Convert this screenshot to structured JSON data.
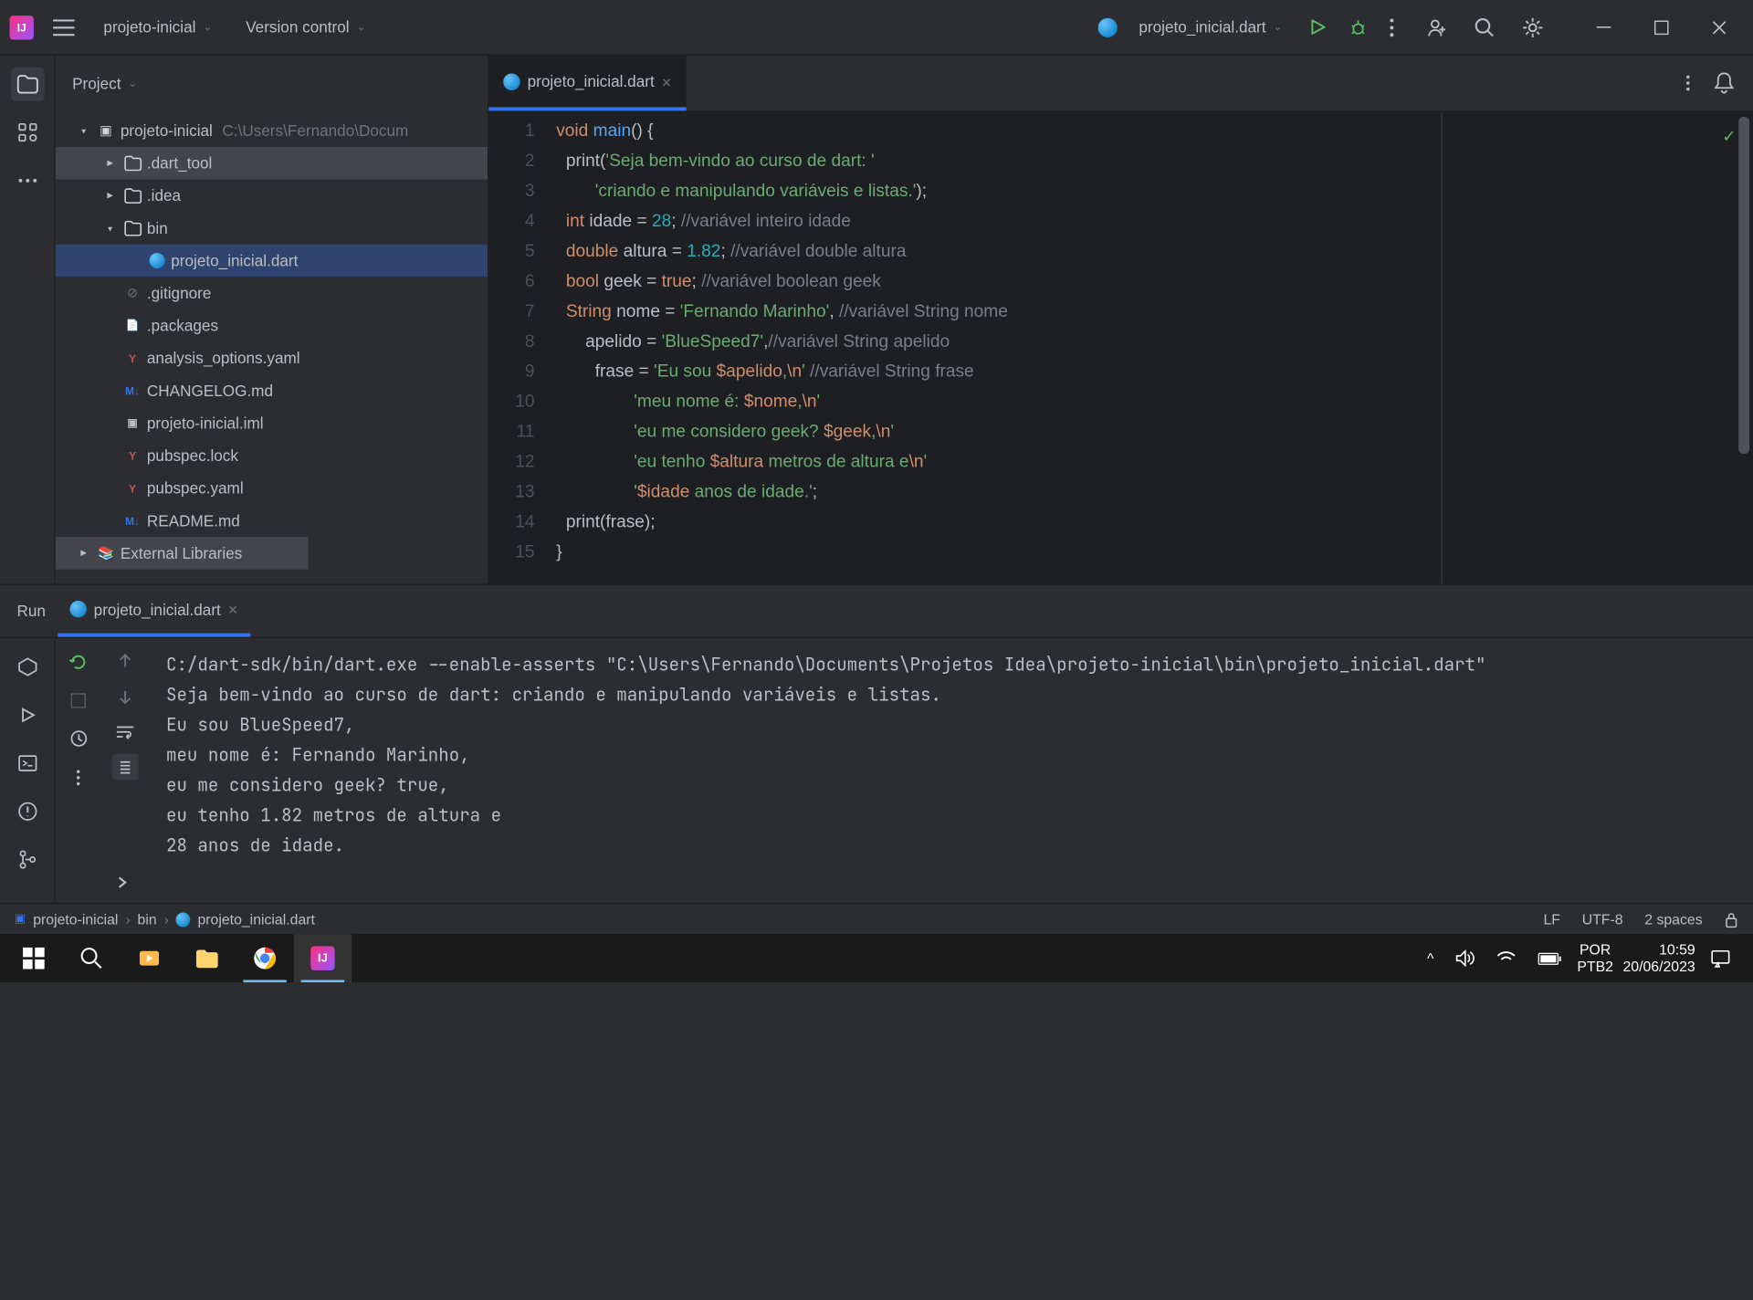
{
  "titlebar": {
    "project_name": "projeto-inicial",
    "vcs": "Version control",
    "run_config": "projeto_inicial.dart"
  },
  "panel": {
    "title": "Project"
  },
  "tree": {
    "root": "projeto-inicial",
    "root_path": "C:\\Users\\Fernando\\Docum",
    "items": [
      {
        "label": ".dart_tool",
        "type": "folder",
        "indent": 1,
        "arrow": "right",
        "highlighted": true
      },
      {
        "label": ".idea",
        "type": "folder",
        "indent": 1,
        "arrow": "right"
      },
      {
        "label": "bin",
        "type": "folder",
        "indent": 1,
        "arrow": "down"
      },
      {
        "label": "projeto_inicial.dart",
        "type": "dart",
        "indent": 2,
        "selected": true
      },
      {
        "label": ".gitignore",
        "type": "ignore",
        "indent": 1
      },
      {
        "label": ".packages",
        "type": "file",
        "indent": 1
      },
      {
        "label": "analysis_options.yaml",
        "type": "yaml",
        "indent": 1
      },
      {
        "label": "CHANGELOG.md",
        "type": "md",
        "indent": 1
      },
      {
        "label": "projeto-inicial.iml",
        "type": "iml",
        "indent": 1
      },
      {
        "label": "pubspec.lock",
        "type": "yaml",
        "indent": 1
      },
      {
        "label": "pubspec.yaml",
        "type": "yaml",
        "indent": 1
      },
      {
        "label": "README.md",
        "type": "md",
        "indent": 1
      }
    ],
    "external": "External Libraries"
  },
  "tabs": {
    "current": "projeto_inicial.dart"
  },
  "code": {
    "lines": [
      {
        "n": 1,
        "tokens": [
          [
            "kw",
            "void"
          ],
          [
            "op",
            " "
          ],
          [
            "fn",
            "main"
          ],
          [
            "op",
            "() {"
          ]
        ]
      },
      {
        "n": 2,
        "tokens": [
          [
            "op",
            "  print("
          ],
          [
            "str",
            "'Seja bem-vindo ao curso de dart: '"
          ]
        ]
      },
      {
        "n": 3,
        "tokens": [
          [
            "op",
            "        "
          ],
          [
            "str",
            "'criando e manipulando variáveis e listas.'"
          ],
          [
            "op",
            ");"
          ]
        ]
      },
      {
        "n": 4,
        "tokens": [
          [
            "op",
            "  "
          ],
          [
            "kw",
            "int"
          ],
          [
            "op",
            " idade = "
          ],
          [
            "num",
            "28"
          ],
          [
            "op",
            "; "
          ],
          [
            "cm",
            "//variável inteiro idade"
          ]
        ]
      },
      {
        "n": 5,
        "tokens": [
          [
            "op",
            "  "
          ],
          [
            "kw",
            "double"
          ],
          [
            "op",
            " altura = "
          ],
          [
            "num",
            "1.82"
          ],
          [
            "op",
            "; "
          ],
          [
            "cm",
            "//variável double altura"
          ]
        ]
      },
      {
        "n": 6,
        "tokens": [
          [
            "op",
            "  "
          ],
          [
            "kw",
            "bool"
          ],
          [
            "op",
            " geek = "
          ],
          [
            "kw",
            "true"
          ],
          [
            "op",
            "; "
          ],
          [
            "cm",
            "//variável boolean geek"
          ]
        ]
      },
      {
        "n": 7,
        "tokens": [
          [
            "op",
            "  "
          ],
          [
            "kw",
            "String"
          ],
          [
            "op",
            " nome = "
          ],
          [
            "str",
            "'Fernando Marinho'"
          ],
          [
            "op",
            ", "
          ],
          [
            "cm",
            "//variável String nome"
          ]
        ]
      },
      {
        "n": 8,
        "tokens": [
          [
            "op",
            "      apelido = "
          ],
          [
            "str",
            "'BlueSpeed7'"
          ],
          [
            "op",
            ","
          ],
          [
            "cm",
            "//variável String apelido"
          ]
        ]
      },
      {
        "n": 9,
        "tokens": [
          [
            "op",
            "        frase = "
          ],
          [
            "str",
            "'Eu sou "
          ],
          [
            "tpl",
            "$apelido"
          ],
          [
            "str",
            ","
          ],
          [
            "tpl",
            "\\n"
          ],
          [
            "str",
            "'"
          ],
          [
            "op",
            " "
          ],
          [
            "cm",
            "//variável String frase"
          ]
        ]
      },
      {
        "n": 10,
        "tokens": [
          [
            "op",
            "                "
          ],
          [
            "str",
            "'meu nome é: "
          ],
          [
            "tpl",
            "$nome"
          ],
          [
            "str",
            ","
          ],
          [
            "tpl",
            "\\n"
          ],
          [
            "str",
            "'"
          ]
        ]
      },
      {
        "n": 11,
        "tokens": [
          [
            "op",
            "                "
          ],
          [
            "str",
            "'eu me considero geek? "
          ],
          [
            "tpl",
            "$geek"
          ],
          [
            "str",
            ","
          ],
          [
            "tpl",
            "\\n"
          ],
          [
            "str",
            "'"
          ]
        ]
      },
      {
        "n": 12,
        "tokens": [
          [
            "op",
            "                "
          ],
          [
            "str",
            "'eu tenho "
          ],
          [
            "tpl",
            "$altura"
          ],
          [
            "str",
            " metros de altura e"
          ],
          [
            "tpl",
            "\\n"
          ],
          [
            "str",
            "'"
          ]
        ]
      },
      {
        "n": 13,
        "tokens": [
          [
            "op",
            "                "
          ],
          [
            "str",
            "'"
          ],
          [
            "tpl",
            "$idade"
          ],
          [
            "str",
            " anos de idade.'"
          ],
          [
            "op",
            ";"
          ]
        ]
      },
      {
        "n": 14,
        "tokens": [
          [
            "op",
            "  print(frase);"
          ]
        ]
      },
      {
        "n": 15,
        "tokens": [
          [
            "op",
            "}"
          ]
        ]
      }
    ]
  },
  "run": {
    "title": "Run",
    "tab": "projeto_inicial.dart",
    "output": "C:/dart-sdk/bin/dart.exe --enable-asserts \"C:\\Users\\Fernando\\Documents\\Projetos Idea\\projeto-inicial\\bin\\projeto_inicial.dart\"\nSeja bem-vindo ao curso de dart: criando e manipulando variáveis e listas.\nEu sou BlueSpeed7,\nmeu nome é: Fernando Marinho,\neu me considero geek? true,\neu tenho 1.82 metros de altura e\n28 anos de idade."
  },
  "breadcrumb": [
    "projeto-inicial",
    "bin",
    "projeto_inicial.dart"
  ],
  "status": {
    "line_sep": "LF",
    "encoding": "UTF-8",
    "indent": "2 spaces"
  },
  "taskbar": {
    "lang": "POR",
    "kbd": "PTB2",
    "time": "10:59",
    "date": "20/06/2023"
  }
}
